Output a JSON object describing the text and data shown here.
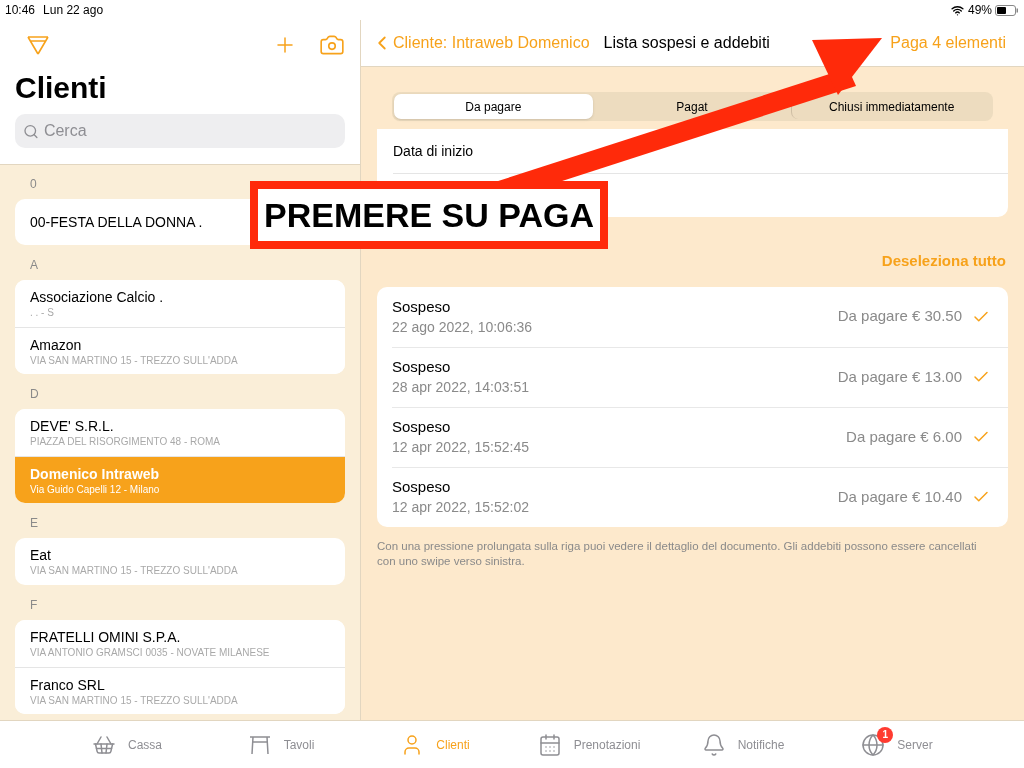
{
  "status_bar": {
    "time": "10:46",
    "date": "Lun 22 ago",
    "battery": "49%"
  },
  "sidebar": {
    "title": "Clienti",
    "search": {
      "placeholder": "Cerca"
    },
    "sections": [
      {
        "letter": "0",
        "clients": [
          {
            "name": "00-FESTA DELLA DONNA .",
            "selected": false
          }
        ]
      },
      {
        "letter": "A",
        "clients": [
          {
            "name": "Associazione Calcio .",
            "address": ". . - S",
            "selected": false
          },
          {
            "name": "Amazon",
            "address": "VIA SAN MARTINO 15  - TREZZO SULL'ADDA",
            "selected": false
          }
        ]
      },
      {
        "letter": "D",
        "clients": [
          {
            "name": "DEVE' S.R.L.",
            "address": "PIAZZA DEL RISORGIMENTO 48  - ROMA",
            "selected": false
          },
          {
            "name": "Domenico Intraweb",
            "address": "Via Guido Capelli 12 - Milano",
            "selected": true
          }
        ]
      },
      {
        "letter": "E",
        "clients": [
          {
            "name": "Eat",
            "address": "VIA SAN MARTINO 15  - TREZZO SULL'ADDA",
            "selected": false
          }
        ]
      },
      {
        "letter": "F",
        "clients": [
          {
            "name": "FRATELLI OMINI S.P.A.",
            "address": "VIA ANTONIO GRAMSCI 0035  - NOVATE MILANESE",
            "selected": false
          },
          {
            "name": "Franco SRL",
            "address": "VIA SAN MARTINO 15  - TREZZO SULL'ADDA",
            "selected": false
          }
        ]
      }
    ]
  },
  "detail": {
    "back": "Cliente: Intraweb Domenico",
    "title": "Lista sospesi e addebiti",
    "action": "Paga 4 elementi",
    "segments": [
      {
        "label": "Da pagare",
        "selected": true
      },
      {
        "label": "Pagat",
        "selected": false
      },
      {
        "label": "Chiusi immediatamente",
        "selected": false
      }
    ],
    "date_fields": [
      {
        "label": "Data di inizio"
      }
    ],
    "deselect": "Deseleziona tutto",
    "items": [
      {
        "title": "Sospeso",
        "date": "22 ago 2022, 10:06:36",
        "amount": "Da pagare € 30.50",
        "checked": true
      },
      {
        "title": "Sospeso",
        "date": "28 apr 2022, 14:03:51",
        "amount": "Da pagare € 13.00",
        "checked": true
      },
      {
        "title": "Sospeso",
        "date": "12 apr 2022, 15:52:45",
        "amount": "Da pagare € 6.00",
        "checked": true
      },
      {
        "title": "Sospeso",
        "date": "12 apr 2022, 15:52:02",
        "amount": "Da pagare € 10.40",
        "checked": true
      }
    ],
    "note": "Con una pressione prolungata sulla riga puoi vedere il dettaglio del documento. Gli addebiti possono essere cancellati con uno swipe verso sinistra."
  },
  "callout": "PREMERE SU PAGA",
  "tab_bar": [
    {
      "kind": "basket",
      "label": "Cassa",
      "selected": false
    },
    {
      "kind": "table",
      "label": "Tavoli",
      "selected": false
    },
    {
      "kind": "person",
      "label": "Clienti",
      "selected": true
    },
    {
      "kind": "calendar",
      "label": "Prenotazioni",
      "selected": false
    },
    {
      "kind": "bell",
      "label": "Notifiche",
      "selected": false
    },
    {
      "kind": "globe",
      "label": "Server",
      "selected": false,
      "badge": "1"
    }
  ]
}
